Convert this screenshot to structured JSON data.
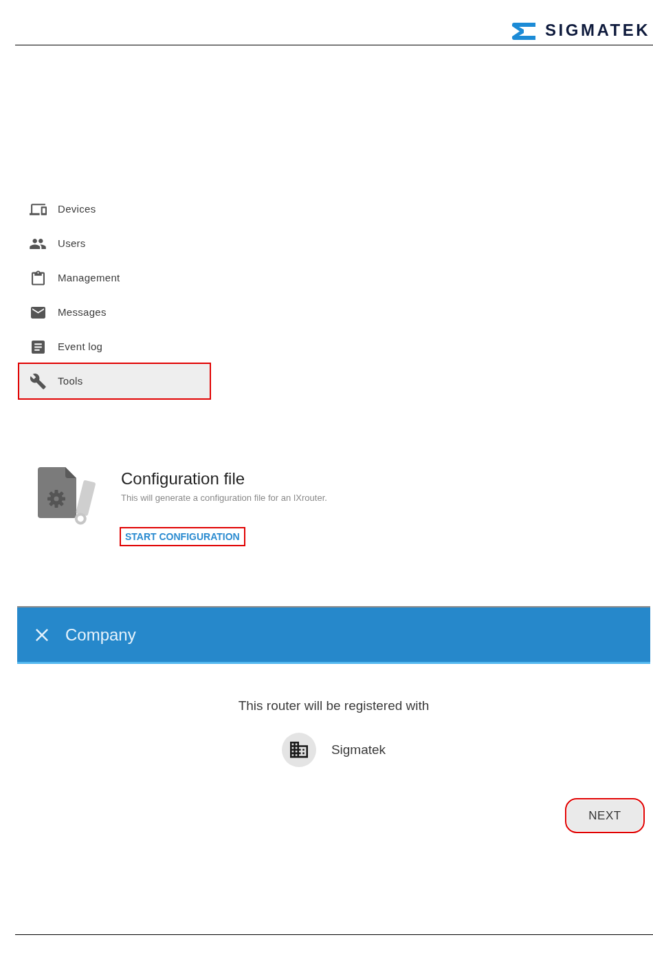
{
  "logo": {
    "text": "SIGMATEK"
  },
  "sidebar": {
    "items": [
      {
        "label": "Devices",
        "selected": false,
        "callout": false
      },
      {
        "label": "Users",
        "selected": false,
        "callout": false
      },
      {
        "label": "Management",
        "selected": false,
        "callout": false
      },
      {
        "label": "Messages",
        "selected": false,
        "callout": false
      },
      {
        "label": "Event log",
        "selected": false,
        "callout": false
      },
      {
        "label": "Tools",
        "selected": true,
        "callout": true
      }
    ]
  },
  "tool_card": {
    "title": "Configuration file",
    "description": "This will generate a configuration file for an IXrouter.",
    "button": {
      "label": "START CONFIGURATION",
      "callout": true
    }
  },
  "dialog": {
    "title": "Company",
    "message": "This router will be registered with",
    "company": {
      "name": "Sigmatek"
    },
    "buttons": [
      {
        "label": "NEXT",
        "callout": true
      }
    ]
  }
}
